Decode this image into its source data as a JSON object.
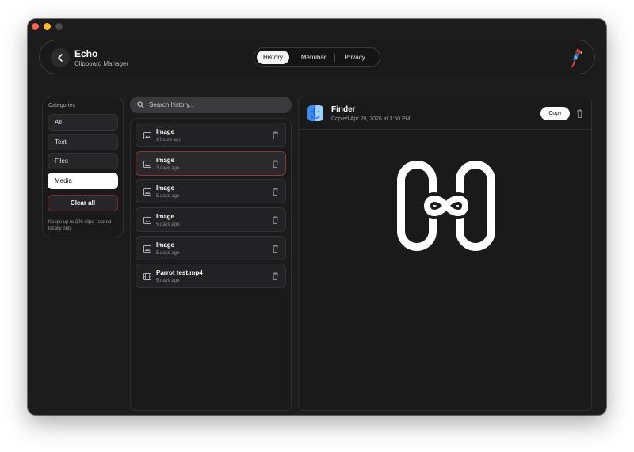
{
  "app": {
    "title": "Echo",
    "subtitle": "Clipboard Manager"
  },
  "nav": {
    "tabs": [
      {
        "label": "History",
        "active": true
      },
      {
        "label": "Menubar"
      },
      {
        "label": "Privacy"
      }
    ]
  },
  "sidebar": {
    "heading": "Categories",
    "items": [
      {
        "label": "All"
      },
      {
        "label": "Text"
      },
      {
        "label": "Files"
      },
      {
        "label": "Media",
        "active": true
      }
    ],
    "clear_label": "Clear all",
    "note": "Keeps up to 200 clips · stored locally only"
  },
  "search": {
    "placeholder": "Search history..."
  },
  "clips": [
    {
      "title": "Image",
      "time": "9 hours ago",
      "icon": "image-icon"
    },
    {
      "title": "Image",
      "time": "3 days ago",
      "icon": "image-icon",
      "selected": true
    },
    {
      "title": "Image",
      "time": "5 days ago",
      "icon": "image-icon"
    },
    {
      "title": "Image",
      "time": "5 days ago",
      "icon": "image-icon"
    },
    {
      "title": "Image",
      "time": "5 days ago",
      "icon": "image-icon"
    },
    {
      "title": "Parrot test.mp4",
      "time": "5 days ago",
      "icon": "video-icon"
    }
  ],
  "detail": {
    "source_app": "Finder",
    "copied": "Copied Apr 20, 2026 at 3:50 PM",
    "copy_label": "Copy",
    "preview": "infinity-link-image"
  },
  "colors": {
    "window_bg": "#1c1c1d",
    "danger_border": "#8a3434",
    "active_bg": "#ffffff"
  }
}
